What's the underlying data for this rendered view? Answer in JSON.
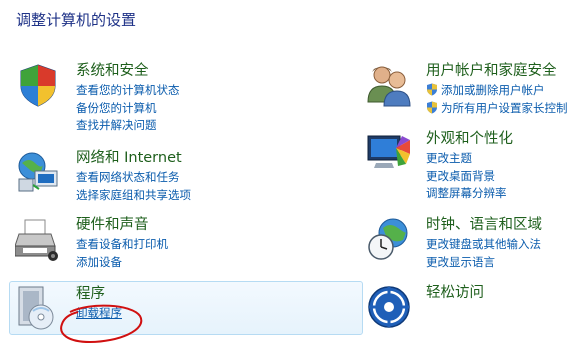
{
  "page_title": "调整计算机的设置",
  "categories": {
    "system": {
      "title": "系统和安全",
      "icon": "shield-icon",
      "links": [
        "查看您的计算机状态",
        "备份您的计算机",
        "查找并解决问题"
      ]
    },
    "network": {
      "title": "网络和 Internet",
      "icon": "globe-network-icon",
      "links": [
        "查看网络状态和任务",
        "选择家庭组和共享选项"
      ]
    },
    "hardware": {
      "title": "硬件和声音",
      "icon": "printer-icon",
      "links": [
        "查看设备和打印机",
        "添加设备"
      ]
    },
    "programs": {
      "title": "程序",
      "icon": "programs-disk-icon",
      "links": [
        "卸载程序"
      ]
    },
    "users": {
      "title": "用户帐户和家庭安全",
      "icon": "users-icon",
      "links": [
        "添加或删除用户帐户",
        "为所有用户设置家长控制"
      ],
      "link_icon": "uac-shield-icon"
    },
    "appearance": {
      "title": "外观和个性化",
      "icon": "monitor-palette-icon",
      "links": [
        "更改主题",
        "更改桌面背景",
        "调整屏幕分辨率"
      ]
    },
    "clock": {
      "title": "时钟、语言和区域",
      "icon": "clock-globe-icon",
      "links": [
        "更改键盘或其他输入法",
        "更改显示语言"
      ]
    },
    "ease": {
      "title": "轻松访问",
      "icon": "ease-of-access-icon",
      "links": []
    }
  },
  "colors": {
    "title": "#1e3287",
    "category_title": "#1e5f1c",
    "link": "#0b5cad",
    "highlight_border": "#b6dbf3",
    "annotation": "#d01010"
  }
}
